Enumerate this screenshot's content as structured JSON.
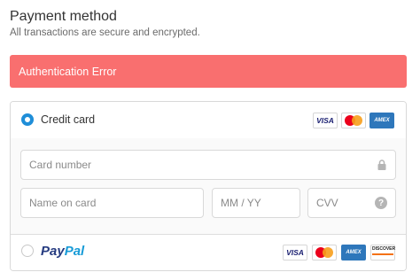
{
  "header": {
    "title": "Payment method",
    "subtitle": "All transactions are secure and encrypted."
  },
  "alert": {
    "message": "Authentication Error",
    "color": "#f96f6f"
  },
  "payment_options": {
    "credit_card": {
      "label": "Credit card",
      "selected": true,
      "logos": [
        "VISA",
        "mastercard",
        "AMEX"
      ]
    },
    "paypal": {
      "logo_part1": "Pay",
      "logo_part2": "Pal",
      "selected": false,
      "logos": [
        "VISA",
        "mastercard",
        "AMEX",
        "discover"
      ]
    }
  },
  "form": {
    "card_number": {
      "placeholder": "Card number",
      "value": "",
      "icon": "lock-icon"
    },
    "name_on_card": {
      "placeholder": "Name on card",
      "value": ""
    },
    "expiry": {
      "placeholder": "MM / YY",
      "value": ""
    },
    "cvv": {
      "placeholder": "CVV",
      "value": "",
      "icon": "help-icon"
    }
  },
  "logo_text": {
    "visa": "VISA",
    "amex": "AMEX",
    "discover": "DISCOVER"
  },
  "colors": {
    "accent": "#1f8ed8",
    "error": "#f96f6f",
    "paypal_dark": "#253b80",
    "paypal_light": "#179bd7"
  }
}
